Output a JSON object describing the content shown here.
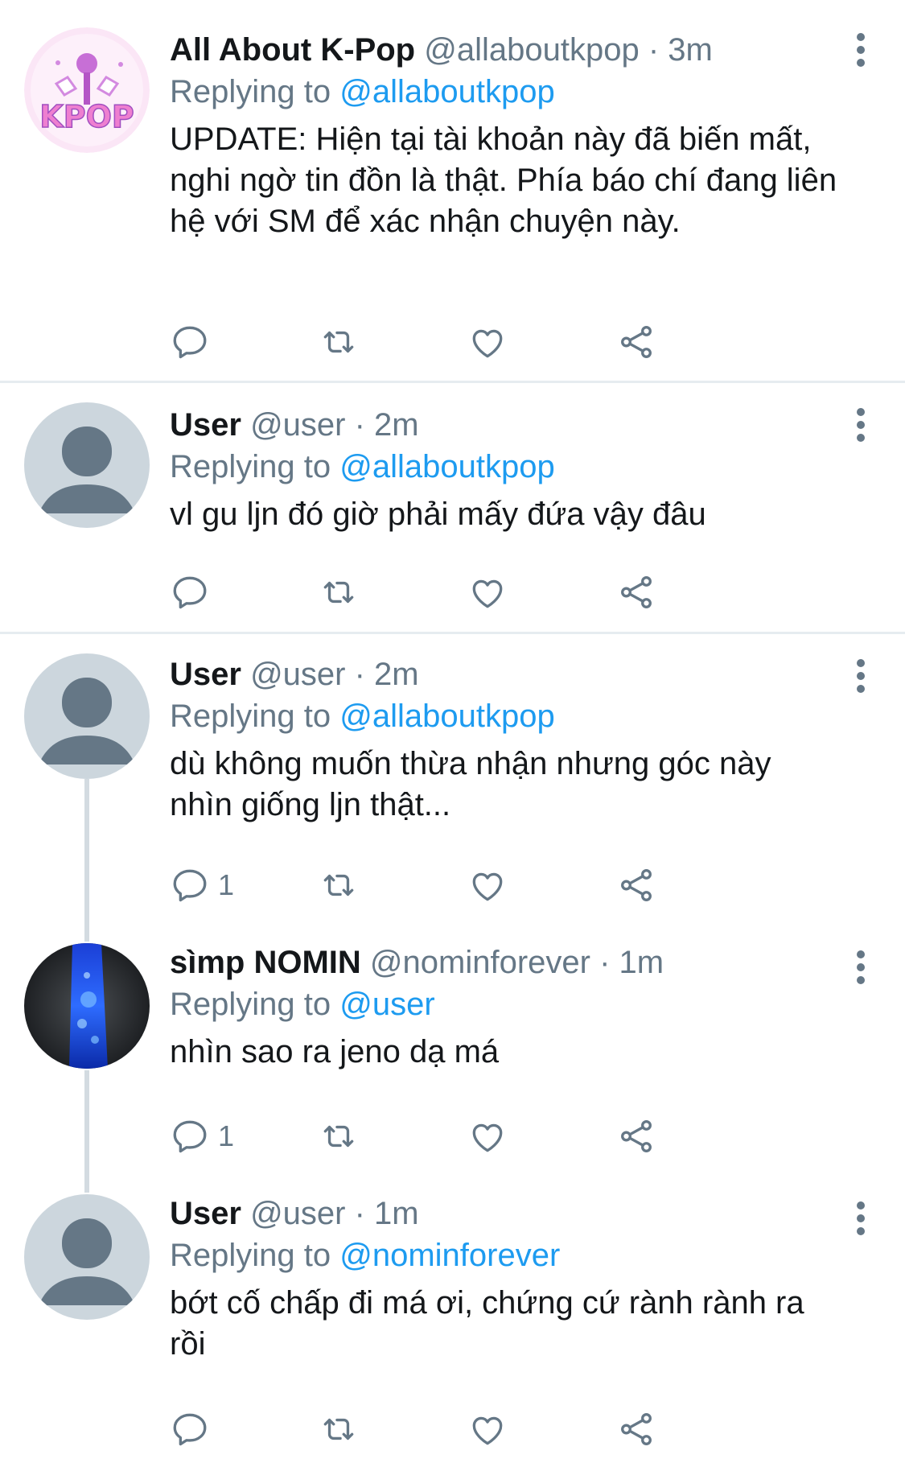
{
  "tweets": [
    {
      "name": "All About K-Pop",
      "handle": "@allaboutkpop",
      "time": "· 3m",
      "replying_prefix": "Replying to ",
      "replying_to": "@allaboutkpop",
      "text": "UPDATE: Hiện tại tài khoản này đã biến mất, nghi ngờ tin đồn là thật. Phía báo chí đang liên hệ với SM để xác nhận chuyện này.",
      "avatar_text": "KPOP",
      "reply_count": ""
    },
    {
      "name": "User",
      "handle": "@user",
      "time": "· 2m",
      "replying_prefix": "Replying to ",
      "replying_to": "@allaboutkpop",
      "text": "vl gu ljn đó giờ phải mấy đứa vậy đâu",
      "reply_count": ""
    },
    {
      "name": "User",
      "handle": "@user",
      "time": "· 2m",
      "replying_prefix": "Replying to ",
      "replying_to": "@allaboutkpop",
      "text": "dù không muốn thừa nhận nhưng góc này nhìn giống ljn thật...",
      "reply_count": "1"
    },
    {
      "name": "sìmp NOMIN",
      "handle": "@nominforever",
      "time": "· 1m",
      "replying_prefix": "Replying to ",
      "replying_to": "@user",
      "text": "nhìn sao ra jeno dạ má",
      "reply_count": "1"
    },
    {
      "name": "User",
      "handle": "@user",
      "time": "· 1m",
      "replying_prefix": "Replying to ",
      "replying_to": "@nominforever",
      "text": "bớt cố chấp đi má ơi, chứng cứ rành rành ra rồi",
      "reply_count": ""
    }
  ],
  "icons": {
    "reply": "reply-icon",
    "retweet": "retweet-icon",
    "like": "heart-icon",
    "share": "share-icon",
    "more": "more-options-icon"
  },
  "colors": {
    "icon_gray": "#657786",
    "link_blue": "#1d9bf0",
    "divider": "#e6ecf0",
    "avatar_placeholder_bg": "#ccd6dd"
  }
}
